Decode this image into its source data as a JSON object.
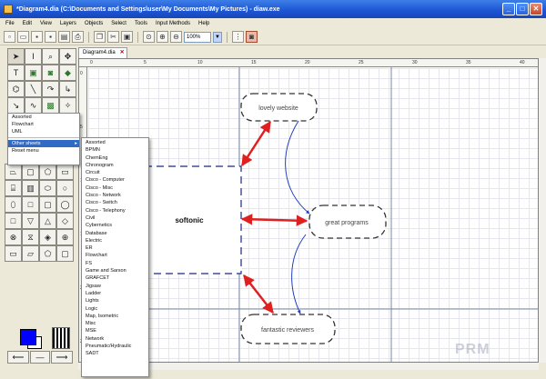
{
  "window": {
    "title": "*Diagram4.dia (C:\\Documents and Settings\\user\\My Documents\\My Pictures) - diaw.exe"
  },
  "menu": [
    "File",
    "Edit",
    "View",
    "Layers",
    "Objects",
    "Select",
    "Tools",
    "Input Methods",
    "Help"
  ],
  "toolbar": {
    "zoom": "100%"
  },
  "tab": {
    "label": "Diagram4.dia"
  },
  "ruler": {
    "h_ticks": [
      "0",
      "5",
      "10",
      "15",
      "20",
      "25",
      "30",
      "35",
      "40"
    ],
    "v_ticks": [
      "0",
      "5",
      "10",
      "15",
      "20",
      "25"
    ]
  },
  "sheet_menu": {
    "items": [
      "Assorted",
      "Flowchart",
      "UML"
    ],
    "other_sheets": "Other sheets",
    "arrow": "▸",
    "reset": "Reset menu"
  },
  "submenu": [
    "Assorted",
    "BPMN",
    "ChemEng",
    "Chronogram",
    "Circuit",
    "Cisco - Computer",
    "Cisco - Misc",
    "Cisco - Network",
    "Cisco - Switch",
    "Cisco - Telephony",
    "Civil",
    "Cybernetics",
    "Database",
    "Electric",
    "ER",
    "Flowchart",
    "FS",
    "Game and Sarson",
    "GRAFCET",
    "Jigsaw",
    "Ladder",
    "Lights",
    "Logic",
    "Map, Isometric",
    "Misc",
    "MSE",
    "Network",
    "Pneumatic/Hydraulic",
    "SADT"
  ],
  "diagram": {
    "center": "softonic",
    "top": "lovely website",
    "right": "great programs",
    "bottom": "fantastic reviewers"
  },
  "watermark": "PRM",
  "colors": {
    "arrow_red": "#e0201e",
    "curve_blue": "#1f3fbf",
    "fg_color": "#0000ff",
    "title_blue": "#1c55d3"
  }
}
